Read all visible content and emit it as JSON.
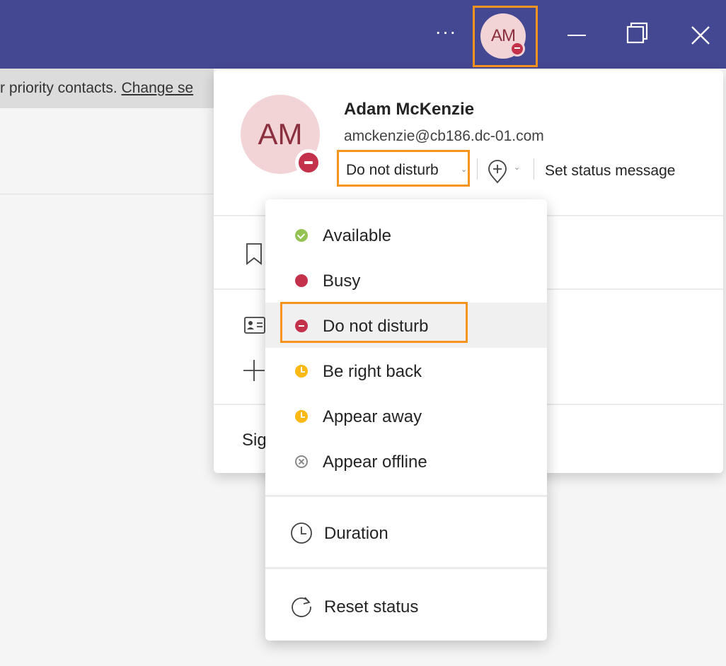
{
  "titlebar": {
    "more_label": "···",
    "avatar_initials": "AM",
    "colors": {
      "background": "#444791",
      "highlight": "#f7941d"
    }
  },
  "background": {
    "info_text": "r priority contacts. ",
    "info_link": "Change se"
  },
  "profile": {
    "initials": "AM",
    "name": "Adam McKenzie",
    "email": "amckenzie@cb186.dc-01.com",
    "status_label": "Do not disturb",
    "set_status_label": "Set status message",
    "sign_out_label": "Sign out"
  },
  "status_menu": {
    "items": [
      {
        "label": "Available",
        "icon": "available-icon",
        "color": "#92c353"
      },
      {
        "label": "Busy",
        "icon": "busy-icon",
        "color": "#c4314b"
      },
      {
        "label": "Do not disturb",
        "icon": "do-not-disturb-icon",
        "color": "#c4314b",
        "selected": true
      },
      {
        "label": "Be right back",
        "icon": "be-right-back-icon",
        "color": "#fcb813"
      },
      {
        "label": "Appear away",
        "icon": "appear-away-icon",
        "color": "#fcb813"
      },
      {
        "label": "Appear offline",
        "icon": "appear-offline-icon",
        "color": "#8a8a8a"
      }
    ],
    "duration_label": "Duration",
    "reset_label": "Reset status"
  }
}
